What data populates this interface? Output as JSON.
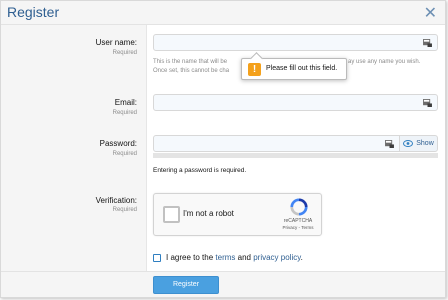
{
  "dialog": {
    "title": "Register",
    "close_icon": "close-icon"
  },
  "form": {
    "username": {
      "label": "User name:",
      "required": "Required",
      "value": "",
      "hint_line1": "This is the name that will be",
      "hint_line1_end": "ay use any name you wish.",
      "hint_line2": "Once set, this cannot be cha"
    },
    "email": {
      "label": "Email:",
      "required": "Required",
      "value": ""
    },
    "password": {
      "label": "Password:",
      "required": "Required",
      "value": "",
      "show_label": "Show",
      "message": "Entering a password is required."
    },
    "verification": {
      "label": "Verification:",
      "required": "Required",
      "captcha_text": "I'm not a robot",
      "captcha_brand": "reCAPTCHA",
      "captcha_links": "Privacy - Terms"
    },
    "agree": {
      "prefix": "I agree to the",
      "terms": "terms",
      "and": "and",
      "privacy": "privacy policy",
      "suffix": "."
    },
    "submit_label": "Register"
  },
  "tooltip": {
    "text": "Please fill out this field.",
    "icon": "warning-icon"
  },
  "colors": {
    "title": "#2f5f91",
    "button": "#4aa0e0",
    "link": "#2f5f91",
    "warning": "#f4a11c"
  }
}
